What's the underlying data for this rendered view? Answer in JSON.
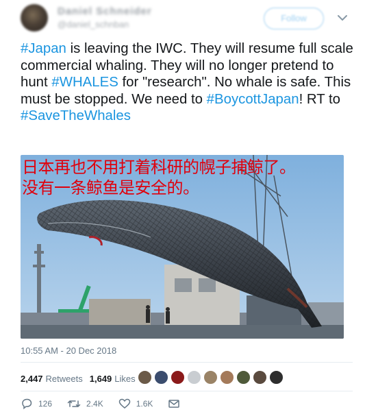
{
  "header": {
    "user_name": "Daniel Schneider",
    "user_handle": "@daniel_schnban",
    "follow_label": "Follow"
  },
  "tweet": {
    "segments": [
      {
        "text": "#Japan",
        "hashtag": true
      },
      {
        "text": " is leaving the IWC. They will resume full scale commercial whaling. They will no longer pretend to hunt ",
        "hashtag": false
      },
      {
        "text": "#WHALES",
        "hashtag": true
      },
      {
        "text": " for \"research\". No whale is safe. This must be stopped. We need to ",
        "hashtag": false
      },
      {
        "text": "#BoycottJapan",
        "hashtag": true
      },
      {
        "text": "! RT to ",
        "hashtag": false
      },
      {
        "text": "#SaveTheWhales",
        "hashtag": true
      }
    ]
  },
  "photo": {
    "overlay_line1": "日本再也不用打着科研的幌子捕鲸了。",
    "overlay_line2": "没有一条鲸鱼是安全的。"
  },
  "timestamp": "10:55 AM - 20 Dec 2018",
  "stats": {
    "retweets_count": "2,447",
    "retweets_label": "Retweets",
    "likes_count": "1,649",
    "likes_label": "Likes"
  },
  "actions": {
    "reply_count": "126",
    "retweet_count": "2.4K",
    "like_count": "1.6K"
  },
  "colors": {
    "hashtag": "#1b95e0",
    "overlay_text": "#e0000c",
    "muted": "#657786"
  }
}
